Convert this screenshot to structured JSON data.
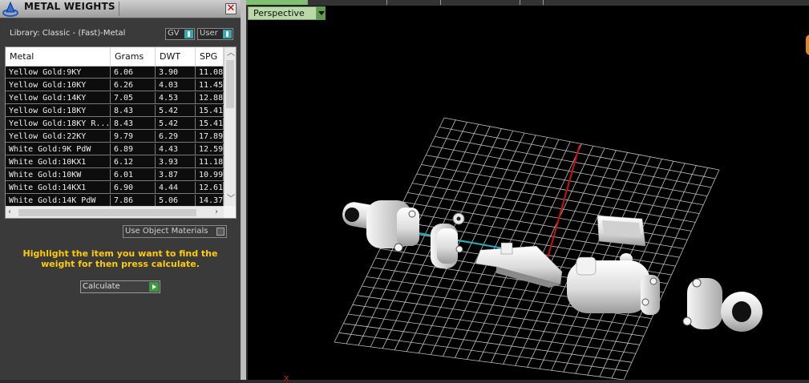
{
  "panel": {
    "title": "METAL WEIGHTS",
    "close_label": "✕",
    "library_label": "Library: Classic - (Fast)-Metal",
    "gv_label": "GV",
    "user_label": "User"
  },
  "table": {
    "columns": [
      "Metal",
      "Grams",
      "DWT",
      "SPG"
    ],
    "rows": [
      [
        "Yellow Gold:9KY",
        "6.06",
        "3.90",
        "11.08"
      ],
      [
        "Yellow Gold:10KY",
        "6.26",
        "4.03",
        "11.45"
      ],
      [
        "Yellow Gold:14KY",
        "7.05",
        "4.53",
        "12.88"
      ],
      [
        "Yellow Gold:18KY",
        "8.43",
        "5.42",
        "15.41"
      ],
      [
        "Yellow Gold:18KY R...",
        "8.43",
        "5.42",
        "15.41"
      ],
      [
        "Yellow Gold:22KY",
        "9.79",
        "6.29",
        "17.89"
      ],
      [
        "White Gold:9K PdW",
        "6.89",
        "4.43",
        "12.59"
      ],
      [
        "White Gold:10KX1",
        "6.12",
        "3.93",
        "11.18"
      ],
      [
        "White Gold:10KW",
        "6.01",
        "3.87",
        "10.99"
      ],
      [
        "White Gold:14KX1",
        "6.90",
        "4.44",
        "12.61"
      ],
      [
        "White Gold:14K PdW",
        "7.86",
        "5.06",
        "14.37"
      ]
    ]
  },
  "options": {
    "use_object_materials_label": "Use Object Materials",
    "hint": "Highlight the item you want to find the weight for then press calculate.",
    "calculate_label": "Calculate"
  },
  "viewport": {
    "view_label": "Perspective",
    "axis_label": "x"
  },
  "colors": {
    "accent_teal": "#3aa7b0",
    "hint_yellow": "#ffcc00",
    "view_button_green": "#b9d9a9",
    "z_axis_red": "#cc1010",
    "x_axis_cyan": "#18b7c8"
  }
}
